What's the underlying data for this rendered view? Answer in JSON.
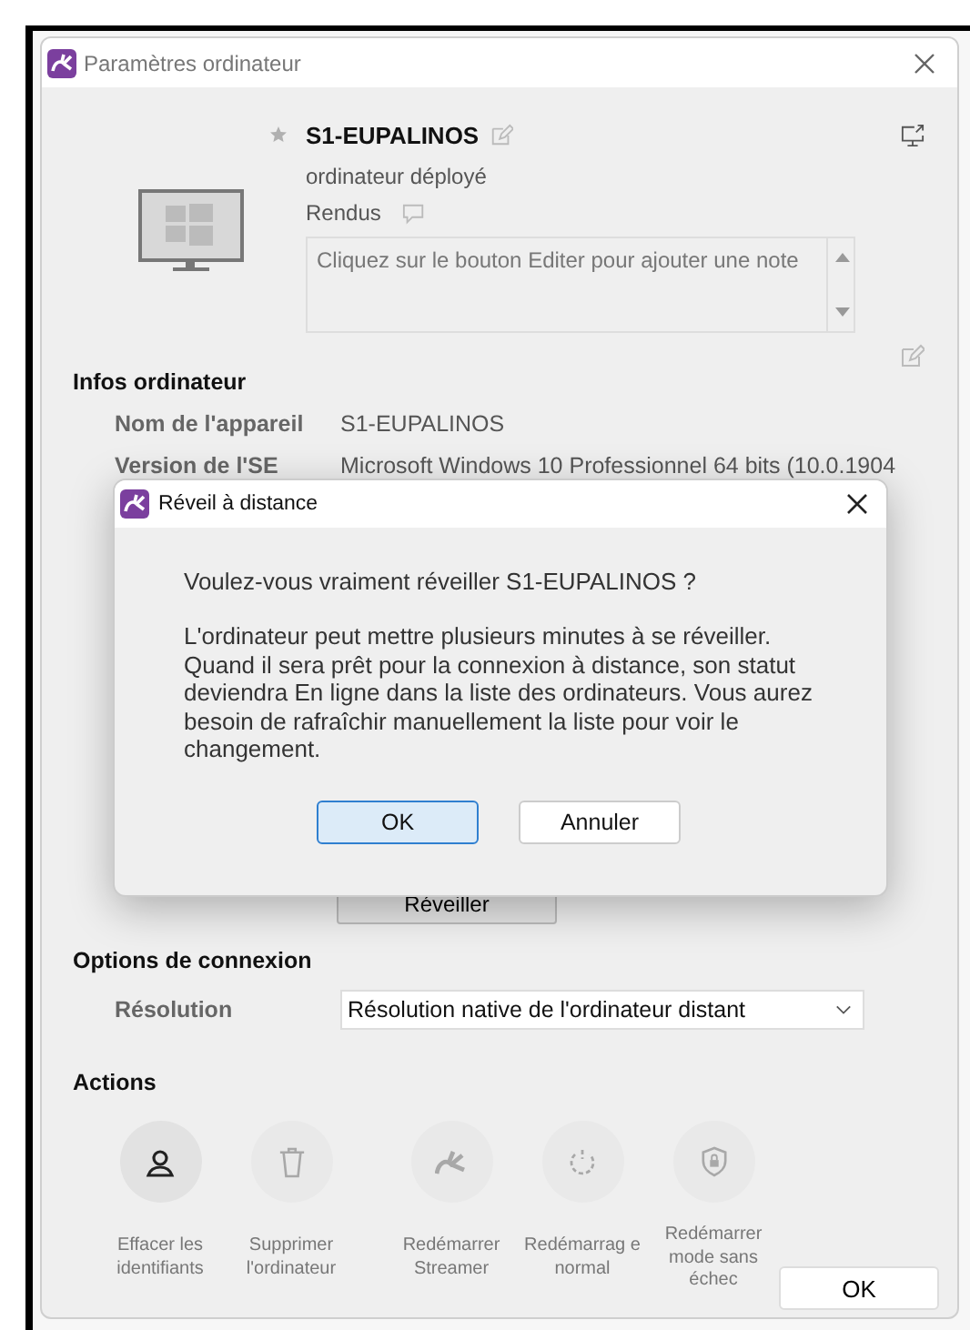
{
  "window": {
    "title": "Paramètres ordinateur"
  },
  "computer": {
    "name": "S1-EUPALINOS",
    "favorite": false,
    "status": "ordinateur déployé",
    "group": "Rendus",
    "note": {
      "placeholder": "Cliquez sur le bouton Editer pour ajouter une note"
    }
  },
  "info": {
    "title": "Infos ordinateur",
    "rows": [
      {
        "label": "Nom de l'appareil",
        "value": "S1-EUPALINOS"
      },
      {
        "label": "Version de l'SE",
        "value": "Microsoft Windows 10 Professionnel 64 bits (10.0.1904"
      }
    ],
    "wake_button": "Réveiller"
  },
  "connection": {
    "title": "Options de connexion",
    "resolution_label": "Résolution",
    "resolution_value": "Résolution native de l'ordinateur distant"
  },
  "actions": {
    "title": "Actions",
    "items": [
      {
        "kind": "user",
        "label": "Effacer les identifiants",
        "disabled": false
      },
      {
        "kind": "trash",
        "label": "Supprimer l'ordinateur",
        "disabled": true
      },
      {
        "kind": "streamer",
        "label": "Redémarrer Streamer",
        "disabled": true
      },
      {
        "kind": "power",
        "label": "Redémarrag e normal",
        "disabled": true
      },
      {
        "kind": "shield",
        "label": "Redémarrer mode sans échec",
        "disabled": true
      }
    ]
  },
  "ok_button": "OK",
  "dialog": {
    "title": "Réveil à distance",
    "question": "Voulez-vous vraiment réveiller S1-EUPALINOS ?",
    "message": "L'ordinateur peut mettre plusieurs minutes à se réveiller. Quand il sera prêt pour la connexion à distance, son statut deviendra En ligne dans la liste des ordinateurs. Vous aurez besoin de rafraîchir manuellement la liste pour voir le changement.",
    "buttons": [
      {
        "label": "OK",
        "selected": true
      },
      {
        "label": "Annuler",
        "selected": false
      }
    ]
  }
}
